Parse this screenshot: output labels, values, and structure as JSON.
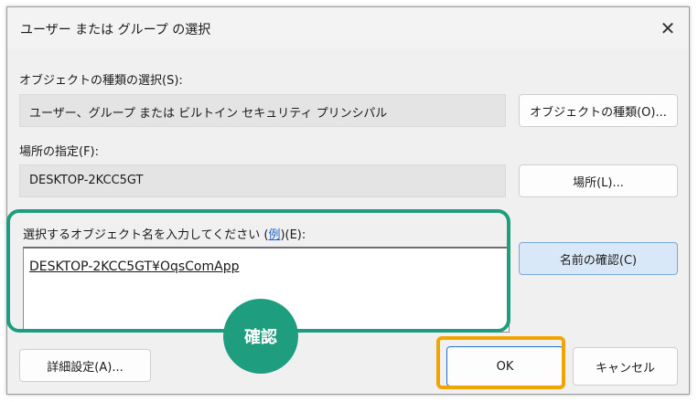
{
  "window": {
    "title": "ユーザー または グループ の選択",
    "close_icon": "close-icon",
    "close_glyph": "✕"
  },
  "object_types": {
    "label": "オブジェクトの種類の選択(S):",
    "value": "ユーザー、グループ または ビルトイン セキュリティ プリンシパル",
    "button": "オブジェクトの種類(O)..."
  },
  "location": {
    "label": "場所の指定(F):",
    "value": "DESKTOP-2KCC5GT",
    "button": "場所(L)..."
  },
  "names": {
    "label_prefix": "選択するオブジェクト名を入力してください (",
    "label_link": "例",
    "label_suffix": ")(E):",
    "value": "DESKTOP-2KCC5GT¥OqsComApp",
    "check_button": "名前の確認(C)"
  },
  "footer": {
    "advanced_button": "詳細設定(A)...",
    "ok_button": "OK",
    "cancel_button": "キャンセル"
  },
  "annotation": {
    "badge_text": "確認",
    "green": "#1f9e7f",
    "orange": "#f2a400"
  }
}
